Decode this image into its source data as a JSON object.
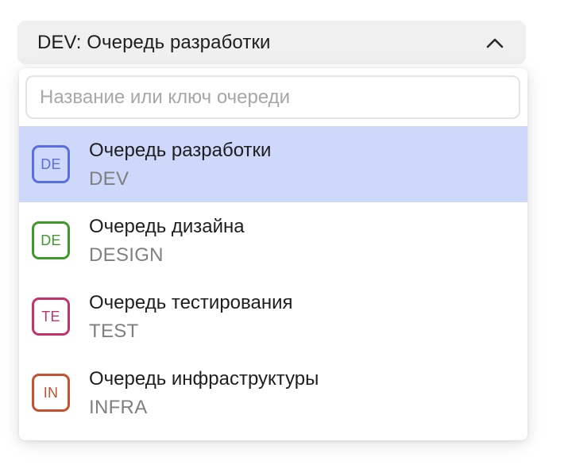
{
  "select": {
    "value": "DEV: Очередь разработки",
    "chevron_icon": "chevron-up-icon"
  },
  "search": {
    "placeholder": "Название или ключ очереди",
    "value": ""
  },
  "options": [
    {
      "badge": "DE",
      "name": "Очередь разработки",
      "key": "DEV",
      "color": "#5b6ee1",
      "selected": true
    },
    {
      "badge": "DE",
      "name": "Очередь дизайна",
      "key": "DESIGN",
      "color": "#3e9a2a",
      "selected": false
    },
    {
      "badge": "TE",
      "name": "Очередь тестирования",
      "key": "TEST",
      "color": "#c2336a",
      "selected": false
    },
    {
      "badge": "IN",
      "name": "Очередь инфраструктуры",
      "key": "INFRA",
      "color": "#c8502e",
      "selected": false
    }
  ],
  "colors": {
    "selected_background": "#cdd8fb",
    "trigger_background": "#f0f0f0"
  }
}
